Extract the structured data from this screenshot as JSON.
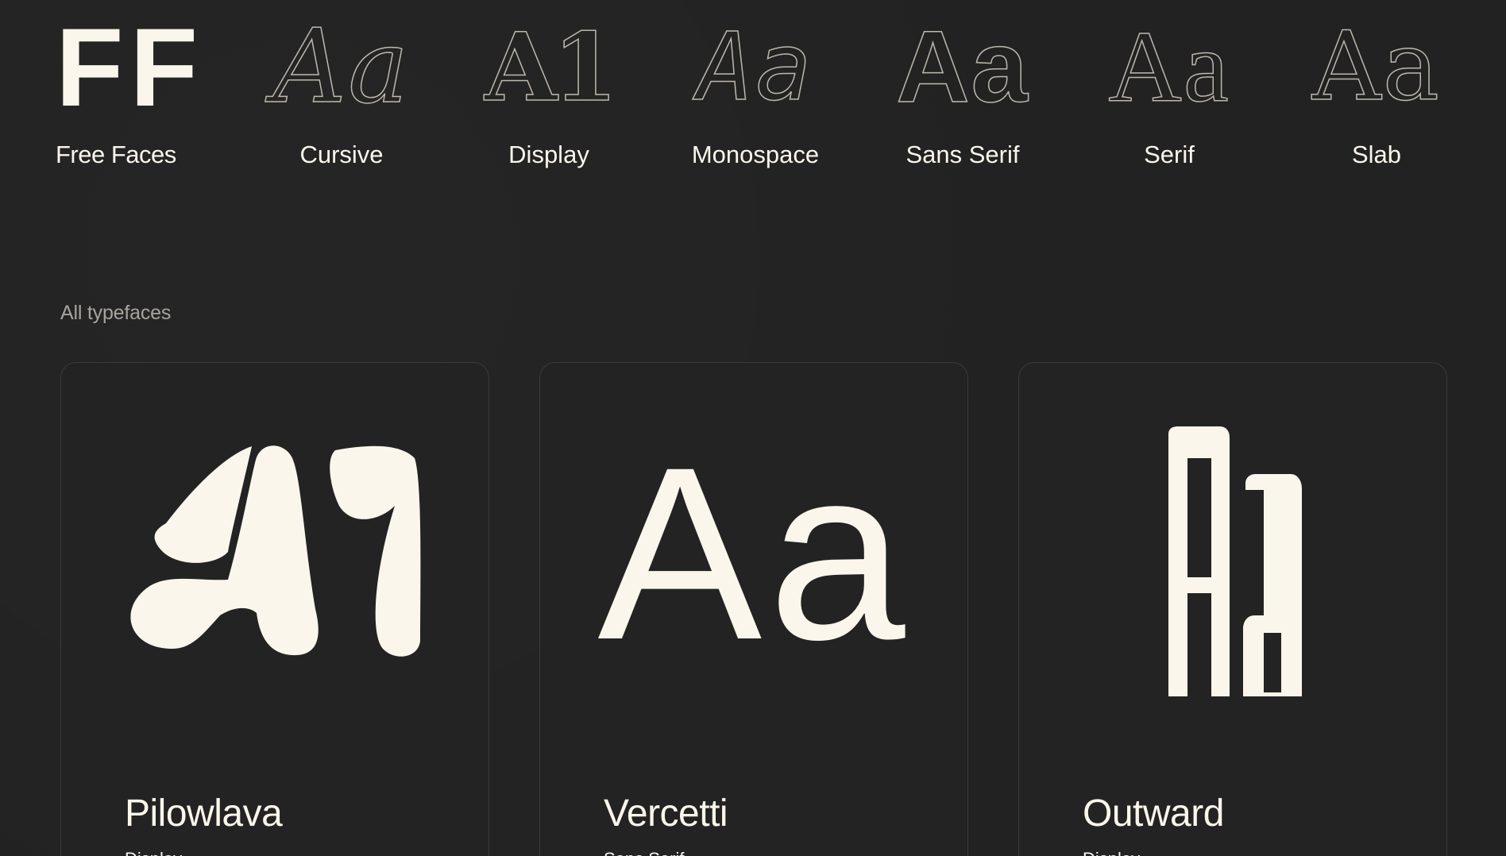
{
  "brand": {
    "logo_text": "FF",
    "name": "Free Faces"
  },
  "categories": [
    {
      "glyph": "Aa",
      "label": "Cursive"
    },
    {
      "glyph": "A1",
      "label": "Display"
    },
    {
      "glyph": "Aa",
      "label": "Monospace"
    },
    {
      "glyph": "Aa",
      "label": "Sans Serif"
    },
    {
      "glyph": "Aa",
      "label": "Serif"
    },
    {
      "glyph": "Aa",
      "label": "Slab"
    }
  ],
  "section": {
    "title": "All typefaces"
  },
  "typefaces": [
    {
      "name": "Pilowlava",
      "category": "Display",
      "specimen": "A1"
    },
    {
      "name": "Vercetti",
      "category": "Sans Serif",
      "specimen": "Aa"
    },
    {
      "name": "Outward",
      "category": "Display",
      "specimen": "Aa"
    }
  ],
  "colors": {
    "background": "#222222",
    "foreground": "#fbf6ec",
    "muted": "#a7a49d",
    "card_border": "#3a3a3a"
  }
}
